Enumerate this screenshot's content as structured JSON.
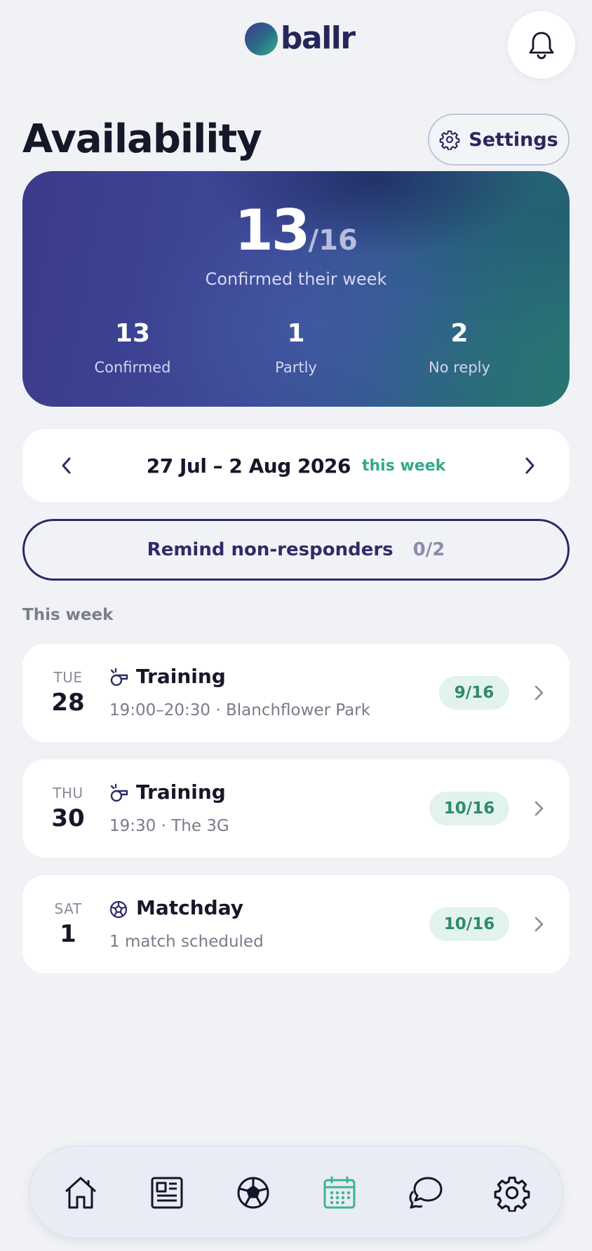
{
  "header": {
    "logo_text": "ballr"
  },
  "page": {
    "title": "Availability",
    "settings_label": "Settings"
  },
  "summary": {
    "confirmed": "13",
    "total": "/16",
    "caption": "Confirmed their week",
    "stats": [
      {
        "value": "13",
        "label": "Confirmed"
      },
      {
        "value": "1",
        "label": "Partly"
      },
      {
        "value": "2",
        "label": "No reply"
      }
    ]
  },
  "week": {
    "range": "27 Jul – 2 Aug 2026",
    "tag": "this week"
  },
  "remind": {
    "label": "Remind non-responders",
    "count": "0/2"
  },
  "section_title": "This week",
  "events": [
    {
      "dow": "TUE",
      "day": "28",
      "icon": "whistle-icon",
      "title": "Training",
      "subtitle": "19:00–20:30 · Blanchflower Park",
      "badge": "9/16"
    },
    {
      "dow": "THU",
      "day": "30",
      "icon": "whistle-icon",
      "title": "Training",
      "subtitle": "19:30 · The 3G",
      "badge": "10/16"
    },
    {
      "dow": "SAT",
      "day": "1",
      "icon": "soccer-ball-icon",
      "title": "Matchday",
      "subtitle": "1 match scheduled",
      "badge": "10/16"
    }
  ],
  "bottom_nav": [
    {
      "icon": "home-icon",
      "active": false
    },
    {
      "icon": "news-icon",
      "active": false
    },
    {
      "icon": "soccer-ball-icon",
      "active": false
    },
    {
      "icon": "calendar-icon",
      "active": true
    },
    {
      "icon": "chat-icon",
      "active": false
    },
    {
      "icon": "gear-icon",
      "active": false
    }
  ],
  "colors": {
    "accent_green": "#36a98b",
    "brand_navy": "#2a2b66",
    "active_nav": "#3fb394",
    "background": "#f1f2f5"
  }
}
